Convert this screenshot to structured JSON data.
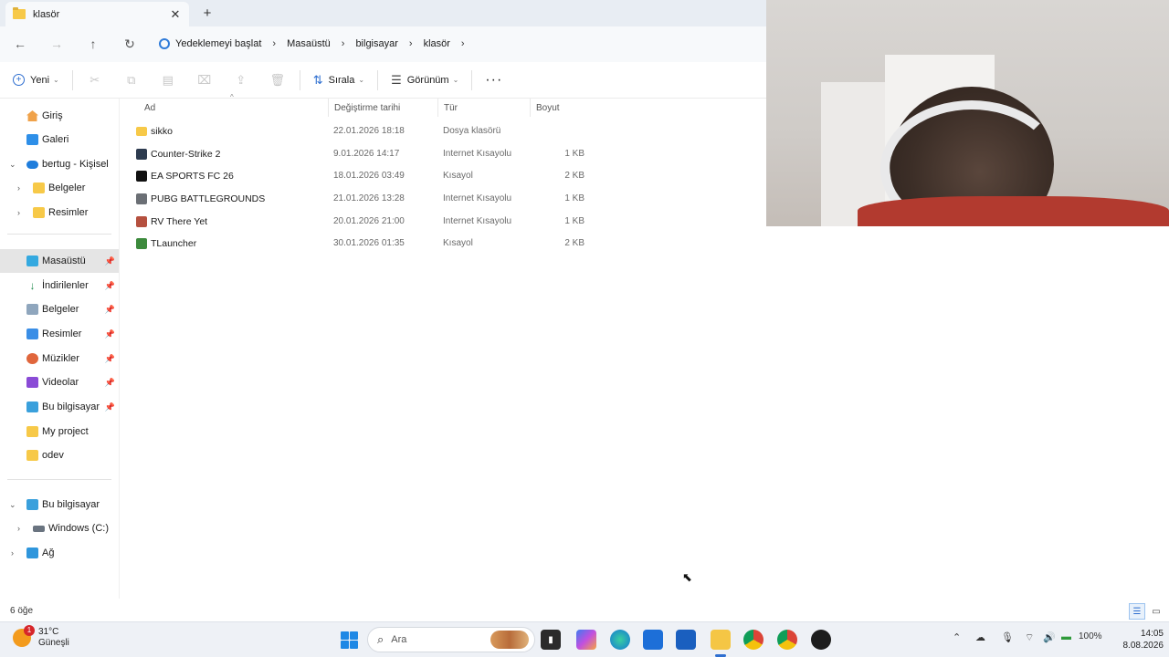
{
  "tab": {
    "title": "klasör",
    "close": "✕",
    "add": "+"
  },
  "nav": {
    "back": "←",
    "forward": "→",
    "up": "↑",
    "refresh": "↻"
  },
  "breadcrumb": {
    "backup": "Yedeklemeyi başlat",
    "items": [
      "Masaüstü",
      "bilgisayar",
      "klasör"
    ],
    "separator": "›"
  },
  "toolbar": {
    "new_label": "Yeni",
    "sort_label": "Sırala",
    "view_label": "Görünüm",
    "more_label": "···"
  },
  "sidebar": {
    "top": [
      {
        "label": "Giriş",
        "icon": "home-icon"
      },
      {
        "label": "Galeri",
        "icon": "gallery-icon"
      },
      {
        "label": "bertug - Kişisel",
        "icon": "cloud-icon"
      },
      {
        "label": "Belgeler",
        "icon": "folder-icon"
      },
      {
        "label": "Resimler",
        "icon": "folder-icon"
      }
    ],
    "quick": [
      {
        "label": "Masaüstü",
        "icon": "desktop-icon"
      },
      {
        "label": "İndirilenler",
        "icon": "download-icon"
      },
      {
        "label": "Belgeler",
        "icon": "documents-icon"
      },
      {
        "label": "Resimler",
        "icon": "pictures-icon"
      },
      {
        "label": "Müzikler",
        "icon": "music-icon"
      },
      {
        "label": "Videolar",
        "icon": "videos-icon"
      },
      {
        "label": "Bu bilgisayar",
        "icon": "pc-icon"
      },
      {
        "label": "My project",
        "icon": "folder-icon"
      },
      {
        "label": "odev",
        "icon": "folder-icon"
      }
    ],
    "bottom": [
      {
        "label": "Bu bilgisayar",
        "icon": "pc-icon"
      },
      {
        "label": "Windows (C:)",
        "icon": "drive-icon"
      },
      {
        "label": "Ağ",
        "icon": "network-icon"
      }
    ]
  },
  "table": {
    "columns": [
      "Ad",
      "Değiştirme tarihi",
      "Tür",
      "Boyut"
    ],
    "rows": [
      {
        "name": "sikko",
        "date": "22.01.2026 18:18",
        "type": "Dosya klasörü",
        "size": ""
      },
      {
        "name": "Counter-Strike 2",
        "date": "9.01.2026 14:17",
        "type": "Internet Kısayolu",
        "size": "1 KB"
      },
      {
        "name": "EA SPORTS FC 26",
        "date": "18.01.2026 03:49",
        "type": "Kısayol",
        "size": "2 KB"
      },
      {
        "name": "PUBG BATTLEGROUNDS",
        "date": "21.01.2026 13:28",
        "type": "Internet Kısayolu",
        "size": "1 KB"
      },
      {
        "name": "RV There Yet",
        "date": "20.01.2026 21:00",
        "type": "Internet Kısayolu",
        "size": "1 KB"
      },
      {
        "name": "TLauncher",
        "date": "30.01.2026 01:35",
        "type": "Kısayol",
        "size": "2 KB"
      }
    ]
  },
  "status": {
    "count": "6 öğe"
  },
  "taskbar": {
    "weather_temp": "31°C",
    "weather_desc": "Güneşli",
    "weather_badge": "1",
    "search_placeholder": "Ara",
    "battery": "100%",
    "time": "14:05",
    "date": "8.08.2026"
  },
  "colors": {
    "accent": "#2f6fd0",
    "folder": "#f7c948",
    "active_row": "#e5e5e5"
  }
}
